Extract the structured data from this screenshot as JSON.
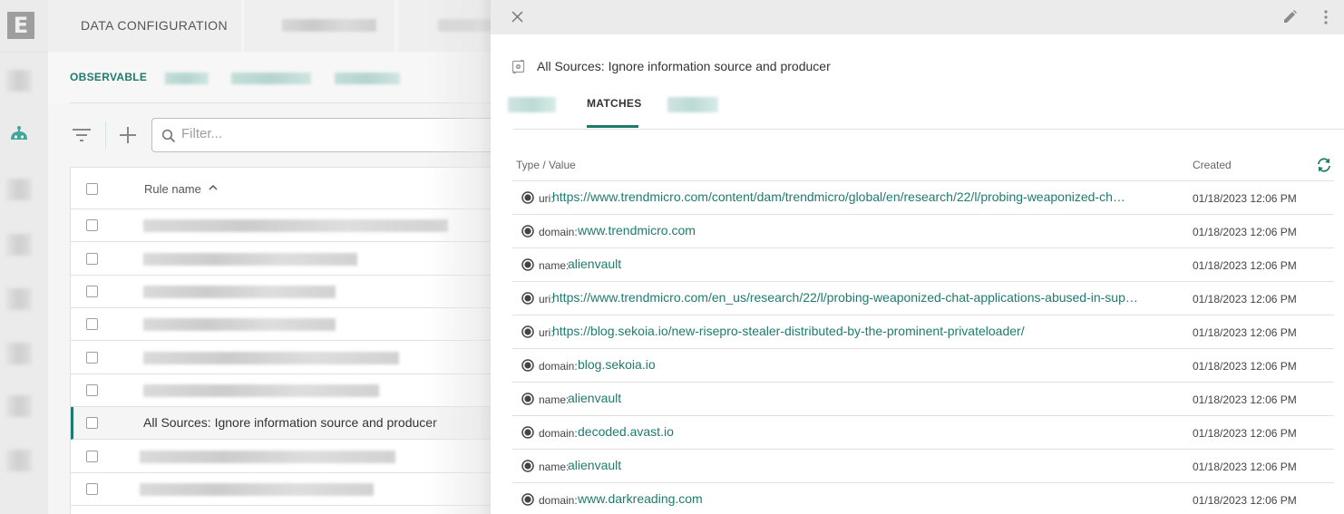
{
  "app": {
    "logo_letter": "E",
    "colors": {
      "accent": "#1e7b6e",
      "robot": "#3ea99a"
    }
  },
  "rail": {
    "items": [
      {
        "icon": "blurred-icon"
      },
      {
        "icon": "robot-icon",
        "active": true
      },
      {
        "icon": "blurred-icon"
      },
      {
        "icon": "blurred-icon"
      },
      {
        "icon": "blurred-icon"
      },
      {
        "icon": "blurred-icon"
      },
      {
        "icon": "blurred-icon"
      },
      {
        "icon": "blurred-icon"
      }
    ]
  },
  "header": {
    "tabs": [
      {
        "label": "DATA CONFIGURATION"
      }
    ]
  },
  "subtabs": {
    "active_label": "OBSERVABLE"
  },
  "toolbar": {
    "filter_placeholder": "Filter...",
    "filter_value": ""
  },
  "rules_table": {
    "header": {
      "rule_name": "Rule name",
      "sort": "ascending"
    },
    "selected_rule": "All Sources: Ignore information source and producer"
  },
  "drawer": {
    "title": "All Sources: Ignore information source and producer",
    "tabs": {
      "active": "MATCHES"
    },
    "columns": {
      "type_value": "Type / Value",
      "created": "Created"
    },
    "matches": [
      {
        "type": "uri:",
        "value": "https://www.trendmicro.com/content/dam/trendmicro/global/en/research/22/l/probing-weaponized-ch…",
        "created": "01/18/2023 12:06 PM"
      },
      {
        "type": "domain:",
        "value": "www.trendmicro.com",
        "created": "01/18/2023 12:06 PM"
      },
      {
        "type": "name:",
        "value": "alienvault",
        "created": "01/18/2023 12:06 PM"
      },
      {
        "type": "uri:",
        "value": "https://www.trendmicro.com/en_us/research/22/l/probing-weaponized-chat-applications-abused-in-sup…",
        "created": "01/18/2023 12:06 PM"
      },
      {
        "type": "uri:",
        "value": "https://blog.sekoia.io/new-risepro-stealer-distributed-by-the-prominent-privateloader/",
        "created": "01/18/2023 12:06 PM"
      },
      {
        "type": "domain:",
        "value": "blog.sekoia.io",
        "created": "01/18/2023 12:06 PM"
      },
      {
        "type": "name:",
        "value": "alienvault",
        "created": "01/18/2023 12:06 PM"
      },
      {
        "type": "domain:",
        "value": "decoded.avast.io",
        "created": "01/18/2023 12:06 PM"
      },
      {
        "type": "name:",
        "value": "alienvault",
        "created": "01/18/2023 12:06 PM"
      },
      {
        "type": "domain:",
        "value": "www.darkreading.com",
        "created": "01/18/2023 12:06 PM"
      }
    ]
  }
}
